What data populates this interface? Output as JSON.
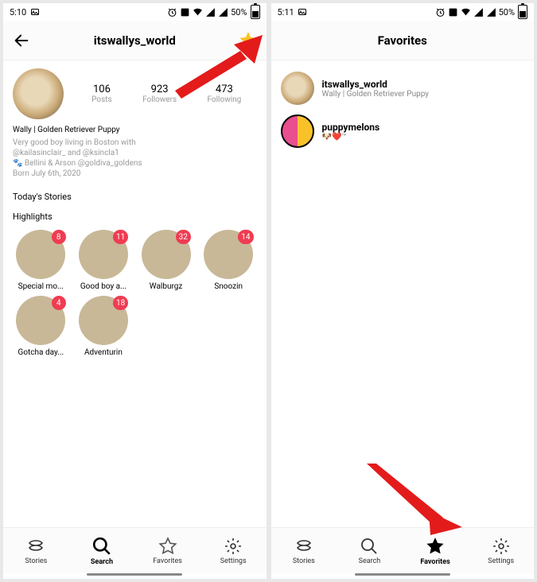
{
  "left": {
    "status": {
      "time": "5:10",
      "battery": "50%"
    },
    "appbar": {
      "title": "itswallys_world"
    },
    "profile": {
      "posts_count": "106",
      "posts_label": "Posts",
      "followers_count": "923",
      "followers_label": "Followers",
      "following_count": "473",
      "following_label": "Following"
    },
    "bio": {
      "name": "Wally | Golden Retriever Puppy",
      "line1": "Very good boy living in Boston with",
      "line2": "@kailasinclair_ and @ksincla1",
      "line3": "🐾 Bellini & Arson @goldiva_goldens",
      "line4": "Born July 6th, 2020"
    },
    "stories_title": "Today's Stories",
    "highlights_title": "Highlights",
    "highlights": [
      {
        "label": "Special mo...",
        "badge": "8"
      },
      {
        "label": "Good boy a...",
        "badge": "11"
      },
      {
        "label": "Walburgz",
        "badge": "32"
      },
      {
        "label": "Snoozin",
        "badge": "14"
      },
      {
        "label": "Gotcha day...",
        "badge": "4"
      },
      {
        "label": "Adventurin",
        "badge": "18"
      }
    ],
    "nav": {
      "stories": "Stories",
      "search": "Search",
      "favorites": "Favorites",
      "settings": "Settings"
    }
  },
  "right": {
    "status": {
      "time": "5:11",
      "battery": "50%"
    },
    "appbar": {
      "title": "Favorites"
    },
    "favorites": [
      {
        "username": "itswallys_world",
        "subtitle": "Wally | Golden Retriever Puppy"
      },
      {
        "username": "puppymelons",
        "subtitle": "🐶❤️™"
      }
    ],
    "nav": {
      "stories": "Stories",
      "search": "Search",
      "favorites": "Favorites",
      "settings": "Settings"
    }
  }
}
